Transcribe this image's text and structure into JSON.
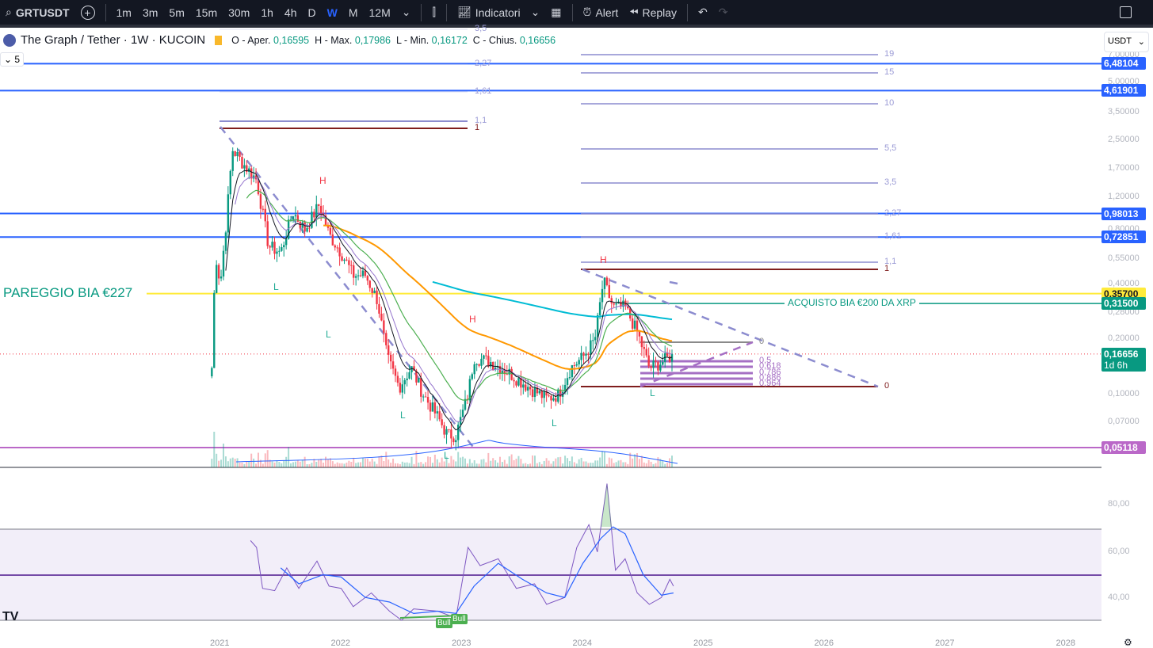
{
  "toolbar": {
    "symbol": "GRTUSDT",
    "intervals": [
      "1m",
      "3m",
      "5m",
      "15m",
      "30m",
      "1h",
      "4h",
      "D",
      "W",
      "M",
      "12M"
    ],
    "active_interval": "W",
    "indicators": "Indicatori",
    "alert": "Alert",
    "replay": "Replay"
  },
  "legend": {
    "title": "The Graph / Tether · 1W · KUCOIN",
    "o_label": "O - Aper.",
    "o": "0,16595",
    "h_label": "H - Max.",
    "h": "0,17986",
    "l_label": "L - Min.",
    "l": "0,16172",
    "c_label": "C - Chius.",
    "c": "0,16656",
    "collapse": "5"
  },
  "currency": "USDT",
  "price_axis": [
    "7,00000",
    "5,00000",
    "3,50000",
    "2,50000",
    "1,70000",
    "1,20000",
    "0,80000",
    "0,55000",
    "0,40000",
    "0,28000",
    "0,20000",
    "0,10000",
    "0,07000"
  ],
  "price_tags": [
    {
      "value": "6,48104",
      "price": 6.48104,
      "color": "#2962ff"
    },
    {
      "value": "4,61901",
      "price": 4.61901,
      "color": "#2962ff"
    },
    {
      "value": "0,98013",
      "price": 0.98013,
      "color": "#2962ff"
    },
    {
      "value": "0,72851",
      "price": 0.72851,
      "color": "#2962ff"
    },
    {
      "value": "0,35700",
      "price": 0.357,
      "color": "#ffeb3b"
    },
    {
      "value": "0,31500",
      "price": 0.315,
      "color": "#089981"
    },
    {
      "value": "0,16656",
      "price": 0.16656,
      "color": "#089981",
      "sub": "1d 6h"
    },
    {
      "value": "0,05118",
      "price": 0.05118,
      "color": "#ba68c8"
    }
  ],
  "annotations": {
    "pareggio": "PAREGGIO BIA €227",
    "acquisto": "ACQUISTO BIA €200 DA XRP",
    "H": "H",
    "L": "L",
    "bull": "Bull"
  },
  "fib_left": [
    "3,5",
    "2,27",
    "1,61",
    "1,1",
    "1"
  ],
  "fib_right": [
    "19",
    "15",
    "10",
    "5,5",
    "3,5",
    "2,27",
    "1,61",
    "1,1",
    "1",
    "0"
  ],
  "fib_small": [
    "0",
    "0,5",
    "0,618",
    "0,786",
    "0,886",
    "0,964"
  ],
  "rsi_axis": [
    "80,00",
    "60,00",
    "40,00"
  ],
  "time_axis": [
    "2021",
    "2022",
    "2023",
    "2024",
    "2025",
    "2026",
    "2027",
    "2028"
  ],
  "price_path": [
    [
      2020.93,
      0.14
    ],
    [
      2020.96,
      0.6
    ],
    [
      2021.0,
      0.4
    ],
    [
      2021.05,
      0.9
    ],
    [
      2021.1,
      2.2
    ],
    [
      2021.2,
      1.8
    ],
    [
      2021.3,
      1.5
    ],
    [
      2021.4,
      0.65
    ],
    [
      2021.5,
      0.6
    ],
    [
      2021.6,
      1.0
    ],
    [
      2021.7,
      0.8
    ],
    [
      2021.82,
      1.1
    ],
    [
      2021.9,
      0.75
    ],
    [
      2022.0,
      0.6
    ],
    [
      2022.1,
      0.45
    ],
    [
      2022.2,
      0.45
    ],
    [
      2022.3,
      0.33
    ],
    [
      2022.38,
      0.16
    ],
    [
      2022.48,
      0.11
    ],
    [
      2022.58,
      0.14
    ],
    [
      2022.68,
      0.1
    ],
    [
      2022.8,
      0.075
    ],
    [
      2022.88,
      0.06
    ],
    [
      2022.95,
      0.06
    ],
    [
      2023.05,
      0.1
    ],
    [
      2023.1,
      0.16
    ],
    [
      2023.25,
      0.15
    ],
    [
      2023.4,
      0.13
    ],
    [
      2023.55,
      0.11
    ],
    [
      2023.7,
      0.095
    ],
    [
      2023.8,
      0.1
    ],
    [
      2023.9,
      0.14
    ],
    [
      2024.0,
      0.16
    ],
    [
      2024.1,
      0.2
    ],
    [
      2024.17,
      0.42
    ],
    [
      2024.25,
      0.3
    ],
    [
      2024.35,
      0.3
    ],
    [
      2024.45,
      0.22
    ],
    [
      2024.55,
      0.14
    ],
    [
      2024.65,
      0.15
    ],
    [
      2024.75,
      0.1666
    ]
  ],
  "rsi_path": [
    [
      2021.25,
      65
    ],
    [
      2021.3,
      62
    ],
    [
      2021.35,
      44
    ],
    [
      2021.45,
      43
    ],
    [
      2021.55,
      53
    ],
    [
      2021.65,
      44
    ],
    [
      2021.8,
      56
    ],
    [
      2021.9,
      45
    ],
    [
      2022.0,
      44
    ],
    [
      2022.1,
      36
    ],
    [
      2022.25,
      42
    ],
    [
      2022.4,
      34
    ],
    [
      2022.5,
      30
    ],
    [
      2022.6,
      35
    ],
    [
      2022.8,
      34
    ],
    [
      2022.95,
      31
    ],
    [
      2023.05,
      62
    ],
    [
      2023.15,
      54
    ],
    [
      2023.3,
      57
    ],
    [
      2023.45,
      44
    ],
    [
      2023.6,
      46
    ],
    [
      2023.7,
      37
    ],
    [
      2023.85,
      40
    ],
    [
      2023.95,
      62
    ],
    [
      2024.05,
      72
    ],
    [
      2024.12,
      60
    ],
    [
      2024.2,
      90
    ],
    [
      2024.27,
      52
    ],
    [
      2024.35,
      57
    ],
    [
      2024.45,
      42
    ],
    [
      2024.55,
      37
    ],
    [
      2024.65,
      40
    ],
    [
      2024.72,
      48
    ],
    [
      2024.75,
      45
    ]
  ],
  "rsi_ma_path": [
    [
      2021.5,
      53
    ],
    [
      2021.65,
      46
    ],
    [
      2021.85,
      50
    ],
    [
      2022.0,
      49
    ],
    [
      2022.2,
      40
    ],
    [
      2022.4,
      38
    ],
    [
      2022.6,
      33
    ],
    [
      2022.8,
      34
    ],
    [
      2022.95,
      33
    ],
    [
      2023.1,
      45
    ],
    [
      2023.3,
      55
    ],
    [
      2023.5,
      48
    ],
    [
      2023.7,
      42
    ],
    [
      2023.85,
      40
    ],
    [
      2024.0,
      55
    ],
    [
      2024.15,
      66
    ],
    [
      2024.25,
      71
    ],
    [
      2024.35,
      68
    ],
    [
      2024.5,
      50
    ],
    [
      2024.65,
      41
    ],
    [
      2024.75,
      42
    ]
  ]
}
